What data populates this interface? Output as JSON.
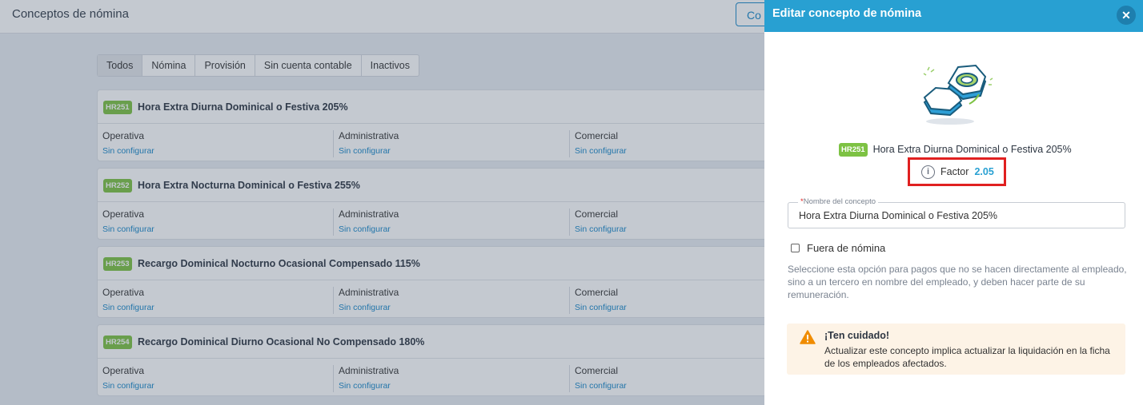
{
  "page": {
    "title": "Conceptos de nómina",
    "top_button_label": "Co"
  },
  "filters": [
    "Todos",
    "Nómina",
    "Provisión",
    "Sin cuenta contable",
    "Inactivos"
  ],
  "concepts": [
    {
      "code": "HR251",
      "title": "Hora Extra Diurna Dominical o Festiva 205%"
    },
    {
      "code": "HR252",
      "title": "Hora Extra Nocturna Dominical o Festiva 255%"
    },
    {
      "code": "HR253",
      "title": "Recargo Dominical Nocturno Ocasional Compensado 115%"
    },
    {
      "code": "HR254",
      "title": "Recargo Dominical Diurno Ocasional No Compensado 180%"
    }
  ],
  "columns": [
    "Operativa",
    "Administrativa",
    "Comercial"
  ],
  "column_status": "Sin configurar",
  "panel": {
    "title": "Editar concepto de nómina",
    "close_icon": "✕",
    "code": "HR251",
    "concept_title": "Hora Extra Diurna Dominical o Festiva 205%",
    "factor_label": "Factor",
    "factor_value": "2.05",
    "info_icon": "i",
    "field": {
      "required_mark": "*",
      "label": "Nombre del concepto",
      "value": "Hora Extra Diurna Dominical o Festiva 205%"
    },
    "checkbox_label": "Fuera de nómina",
    "checkbox_checked": false,
    "help_text": "Seleccione esta opción para pagos que no se hacen directamente al empleado, sino a un tercero en nombre del empleado, y deben hacer parte de su remuneración.",
    "warning": {
      "title": "¡Ten cuidado!",
      "text": "Actualizar este concepto implica actualizar la liquidación en la ficha de los empleados afectados."
    }
  },
  "colors": {
    "header": "#28a0d2",
    "badge": "#7dc243",
    "link": "#1a88c9",
    "highlight_border": "#e02020",
    "warning_bg": "#fdf3e6",
    "warning_icon": "#f08c00"
  }
}
